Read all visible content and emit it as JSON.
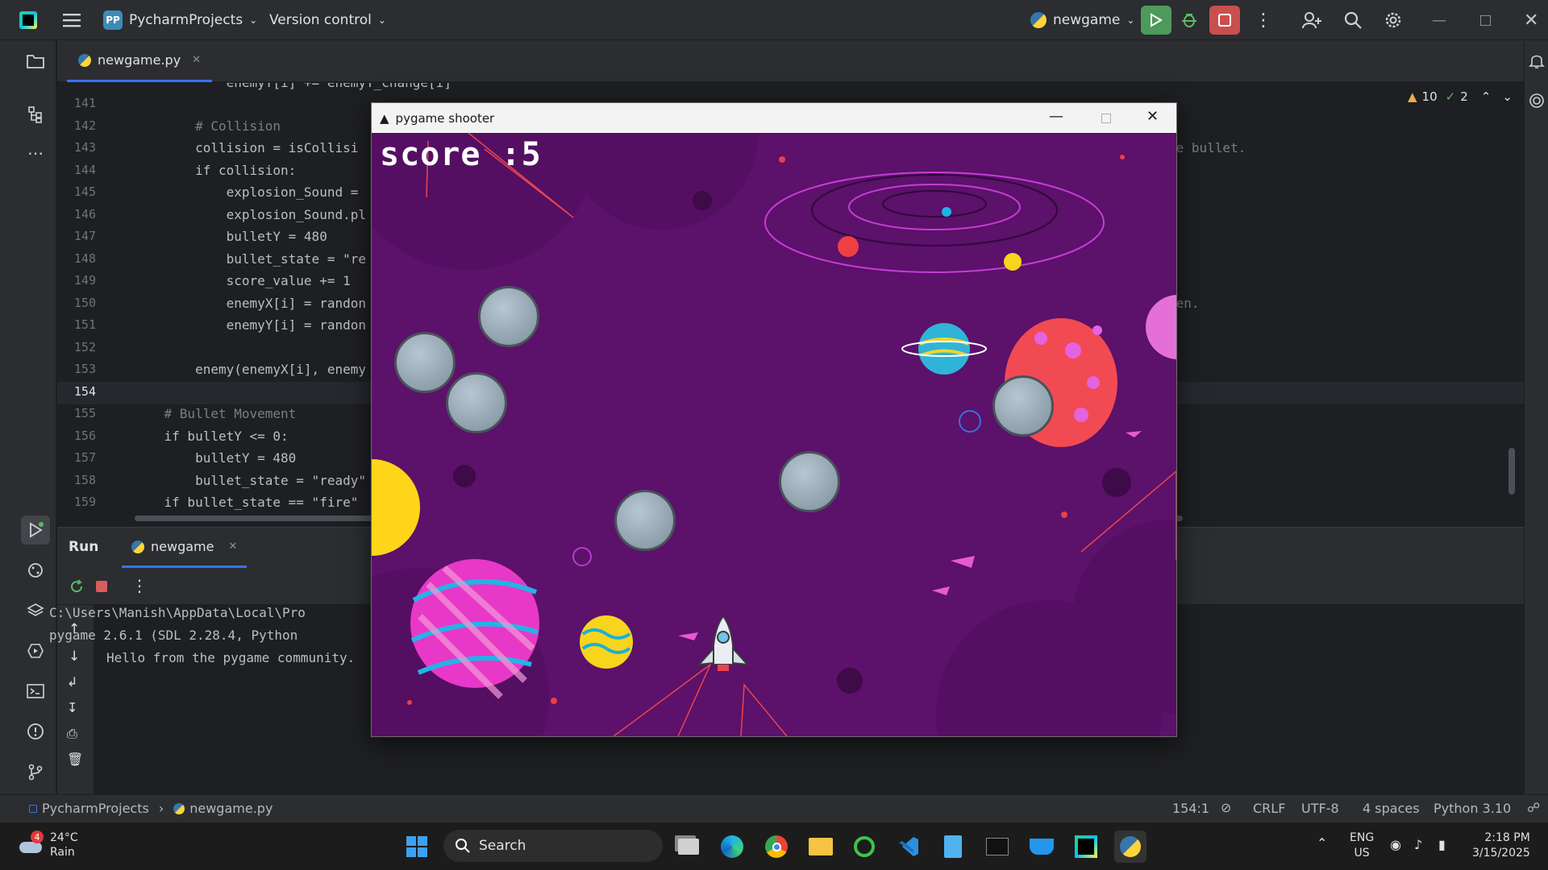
{
  "titlebar": {
    "project_badge": "PP",
    "project": "PycharmProjects",
    "vcs": "Version control",
    "run_config": "newgame"
  },
  "tab": {
    "filename": "newgame.py"
  },
  "inspections": {
    "warnings": "10",
    "checks": "2"
  },
  "editor": {
    "top_partial": "            enemyY[i] += enemyY_change[i]",
    "lines": [
      {
        "n": "141",
        "t": ""
      },
      {
        "n": "142",
        "t": "        # Collision"
      },
      {
        "n": "143",
        "t": "        collision = isCollisi"
      },
      {
        "n": "144",
        "t": "        if collision:"
      },
      {
        "n": "145",
        "t": "            explosion_Sound ="
      },
      {
        "n": "146",
        "t": "            explosion_Sound.pl"
      },
      {
        "n": "147",
        "t": "            bulletY = 480"
      },
      {
        "n": "148",
        "t": "            bullet_state = \"re"
      },
      {
        "n": "149",
        "t": "            score_value += 1"
      },
      {
        "n": "150",
        "t": "            enemyX[i] = randon"
      },
      {
        "n": "151",
        "t": "            enemyY[i] = randon"
      },
      {
        "n": "152",
        "t": ""
      },
      {
        "n": "153",
        "t": "        enemy(enemyX[i], enemy"
      },
      {
        "n": "154",
        "t": ""
      },
      {
        "n": "155",
        "t": "    # Bullet Movement"
      },
      {
        "n": "156",
        "t": "    if bulletY <= 0:"
      },
      {
        "n": "157",
        "t": "        bulletY = 480"
      },
      {
        "n": "158",
        "t": "        bullet_state = \"ready\""
      },
      {
        "n": "159",
        "t": "    if bullet_state == \"fire\""
      }
    ],
    "right_frag_1": "he bullet.",
    "right_frag_2": "een."
  },
  "run": {
    "title": "Run",
    "tab": "newgame",
    "output": [
      "C:\\Users\\Manish\\AppData\\Local\\Pro",
      "pygame 2.6.1 (SDL 2.28.4, Python",
      "Hello from the pygame community."
    ]
  },
  "status": {
    "breadcrumb_project": "PycharmProjects",
    "breadcrumb_file": "newgame.py",
    "position": "154:1",
    "line_sep": "CRLF",
    "encoding": "UTF-8",
    "indent": "4 spaces",
    "interpreter": "Python 3.10"
  },
  "game": {
    "window_title": "pygame shooter",
    "score": "score :5"
  },
  "taskbar": {
    "weather_temp": "24°C",
    "weather_text": "Rain",
    "weather_badge": "4",
    "search": "Search",
    "lang": "ENG",
    "region": "US",
    "time": "2:18 PM",
    "date": "3/15/2025"
  },
  "colors": {
    "accent": "#3574f0",
    "game_bg": "#5c116a",
    "run_green": "#5fb865",
    "stop_red": "#db5c5c"
  }
}
